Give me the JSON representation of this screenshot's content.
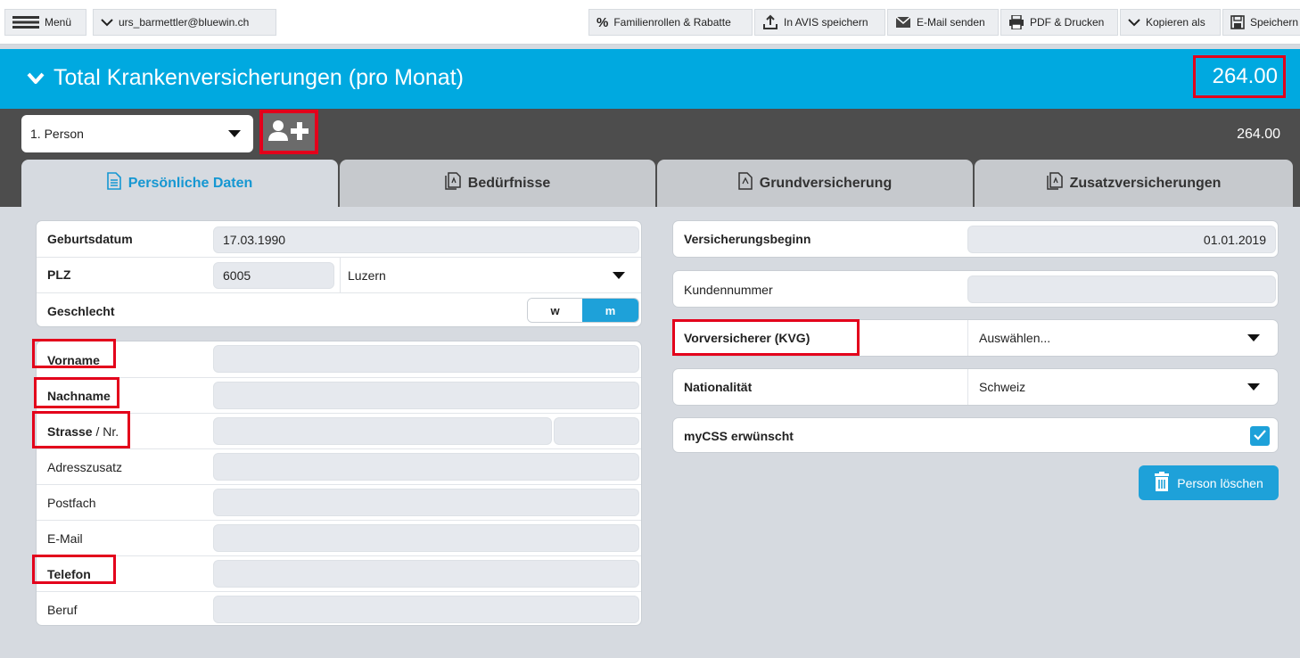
{
  "toolbar": {
    "menu_label": "Menü",
    "user_label": "urs_barmettler@bluewin.ch",
    "family_label": "Familienrollen & Rabatte",
    "avis_label": "In AVIS speichern",
    "email_label": "E-Mail senden",
    "pdf_label": "PDF & Drucken",
    "copy_label": "Kopieren als",
    "save_label": "Speichern"
  },
  "header": {
    "title": "Total Krankenversicherungen (pro Monat)",
    "total": "264.00"
  },
  "person": {
    "selected": "1. Person",
    "total": "264.00"
  },
  "tabs": [
    {
      "label": "Persönliche Daten"
    },
    {
      "label": "Bedürfnisse"
    },
    {
      "label": "Grundversicherung"
    },
    {
      "label": "Zusatzversicherungen"
    }
  ],
  "personal": {
    "birthdate_label": "Geburtsdatum",
    "birthdate_value": "17.03.1990",
    "plz_label": "PLZ",
    "plz_value": "6005",
    "city_value": "Luzern",
    "gender_label": "Geschlecht",
    "gender_w": "w",
    "gender_m": "m",
    "gender_selected": "m"
  },
  "address": {
    "firstname_label": "Vorname",
    "lastname_label": "Nachname",
    "street_label": "Strasse",
    "street_nr_label": " / Nr.",
    "addon_label": "Adresszusatz",
    "postbox_label": "Postfach",
    "email_label": "E-Mail",
    "phone_label": "Telefon",
    "job_label": "Beruf"
  },
  "insurance": {
    "start_label": "Versicherungsbeginn",
    "start_value": "01.01.2019",
    "customer_label": "Kundennummer",
    "prev_label": "Vorversicherer (KVG)",
    "prev_value": "Auswählen...",
    "nationality_label": "Nationalität",
    "nationality_value": "Schweiz",
    "mycss_label": "myCSS erwünscht",
    "mycss_checked": true,
    "delete_label": "Person löschen"
  },
  "colors": {
    "accent": "#00a9e0",
    "highlight": "#e3001b",
    "dark_bar": "#4d4d4d"
  }
}
